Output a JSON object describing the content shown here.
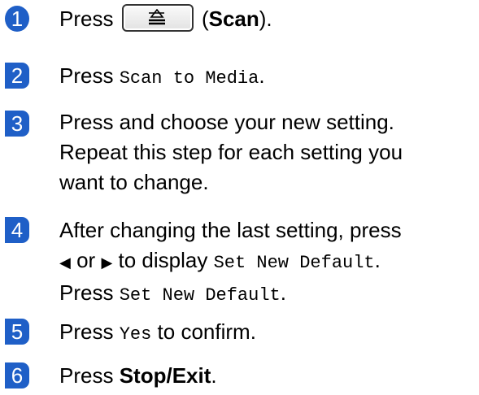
{
  "steps": [
    {
      "number": "1",
      "press": "Press",
      "button_paren_open": "(",
      "button_name": "Scan",
      "button_paren_close": ")."
    },
    {
      "number": "2",
      "press": "Press",
      "mono": "Scan to Media",
      "end": "."
    },
    {
      "number": "3",
      "line1": "Press and choose your new setting.",
      "line2": "Repeat this step for each setting you",
      "line3": "want to change."
    },
    {
      "number": "4",
      "line1": "After changing the last setting, press",
      "left_arrow": "◀",
      "or": "or",
      "right_arrow": "▶",
      "to_display": "to display",
      "mono1": "Set New Default",
      "end1": ".",
      "press": "Press",
      "mono2": "Set New Default",
      "end2": "."
    },
    {
      "number": "5",
      "press": "Press",
      "mono": "Yes",
      "rest": "to confirm."
    },
    {
      "number": "6",
      "press": "Press",
      "bold": "Stop/Exit",
      "end": "."
    }
  ],
  "colors": {
    "badge": "#1f5fc7",
    "text": "#000000"
  },
  "icons": {
    "scan_key": "scan-key-icon"
  }
}
